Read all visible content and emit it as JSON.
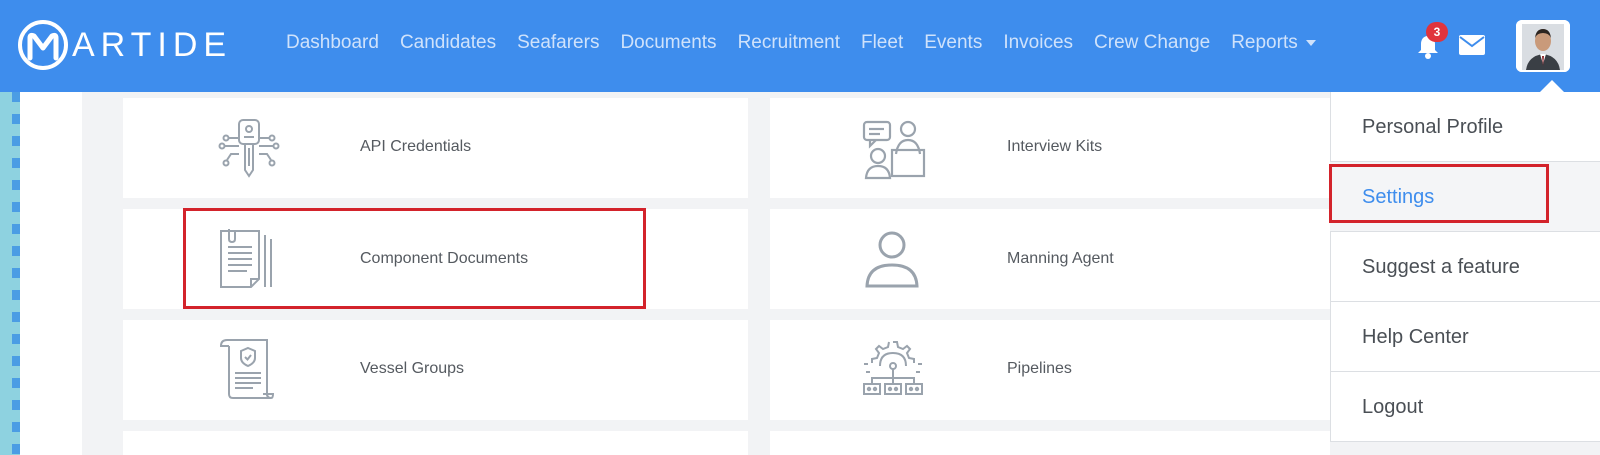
{
  "brand": {
    "name": "ARTIDE"
  },
  "nav": {
    "items": [
      "Dashboard",
      "Candidates",
      "Seafarers",
      "Documents",
      "Recruitment",
      "Fleet",
      "Events",
      "Invoices",
      "Crew Change",
      "Reports"
    ],
    "notifications_count": "3"
  },
  "cards": {
    "api_credentials": "API Credentials",
    "interview_kits": "Interview Kits",
    "component_documents": "Component Documents",
    "manning_agent": "Manning Agent",
    "vessel_groups": "Vessel Groups",
    "pipelines": "Pipelines"
  },
  "user_menu": {
    "items": [
      "Personal Profile",
      "Settings",
      "Suggest a feature",
      "Help Center",
      "Logout"
    ],
    "active": "Settings"
  },
  "colors": {
    "navbar": "#3e8ded",
    "highlight": "#d3232b",
    "icon": "#9aa3ad",
    "active_link": "#3e8ded"
  },
  "icons": {
    "bell": "bell-icon",
    "mail": "envelope-icon",
    "api": "key-circuit-icon",
    "interview": "interview-icon",
    "component": "documents-stack-icon",
    "manning": "user-outline-icon",
    "vessel": "certificate-scroll-icon",
    "pipelines": "gear-network-icon"
  }
}
